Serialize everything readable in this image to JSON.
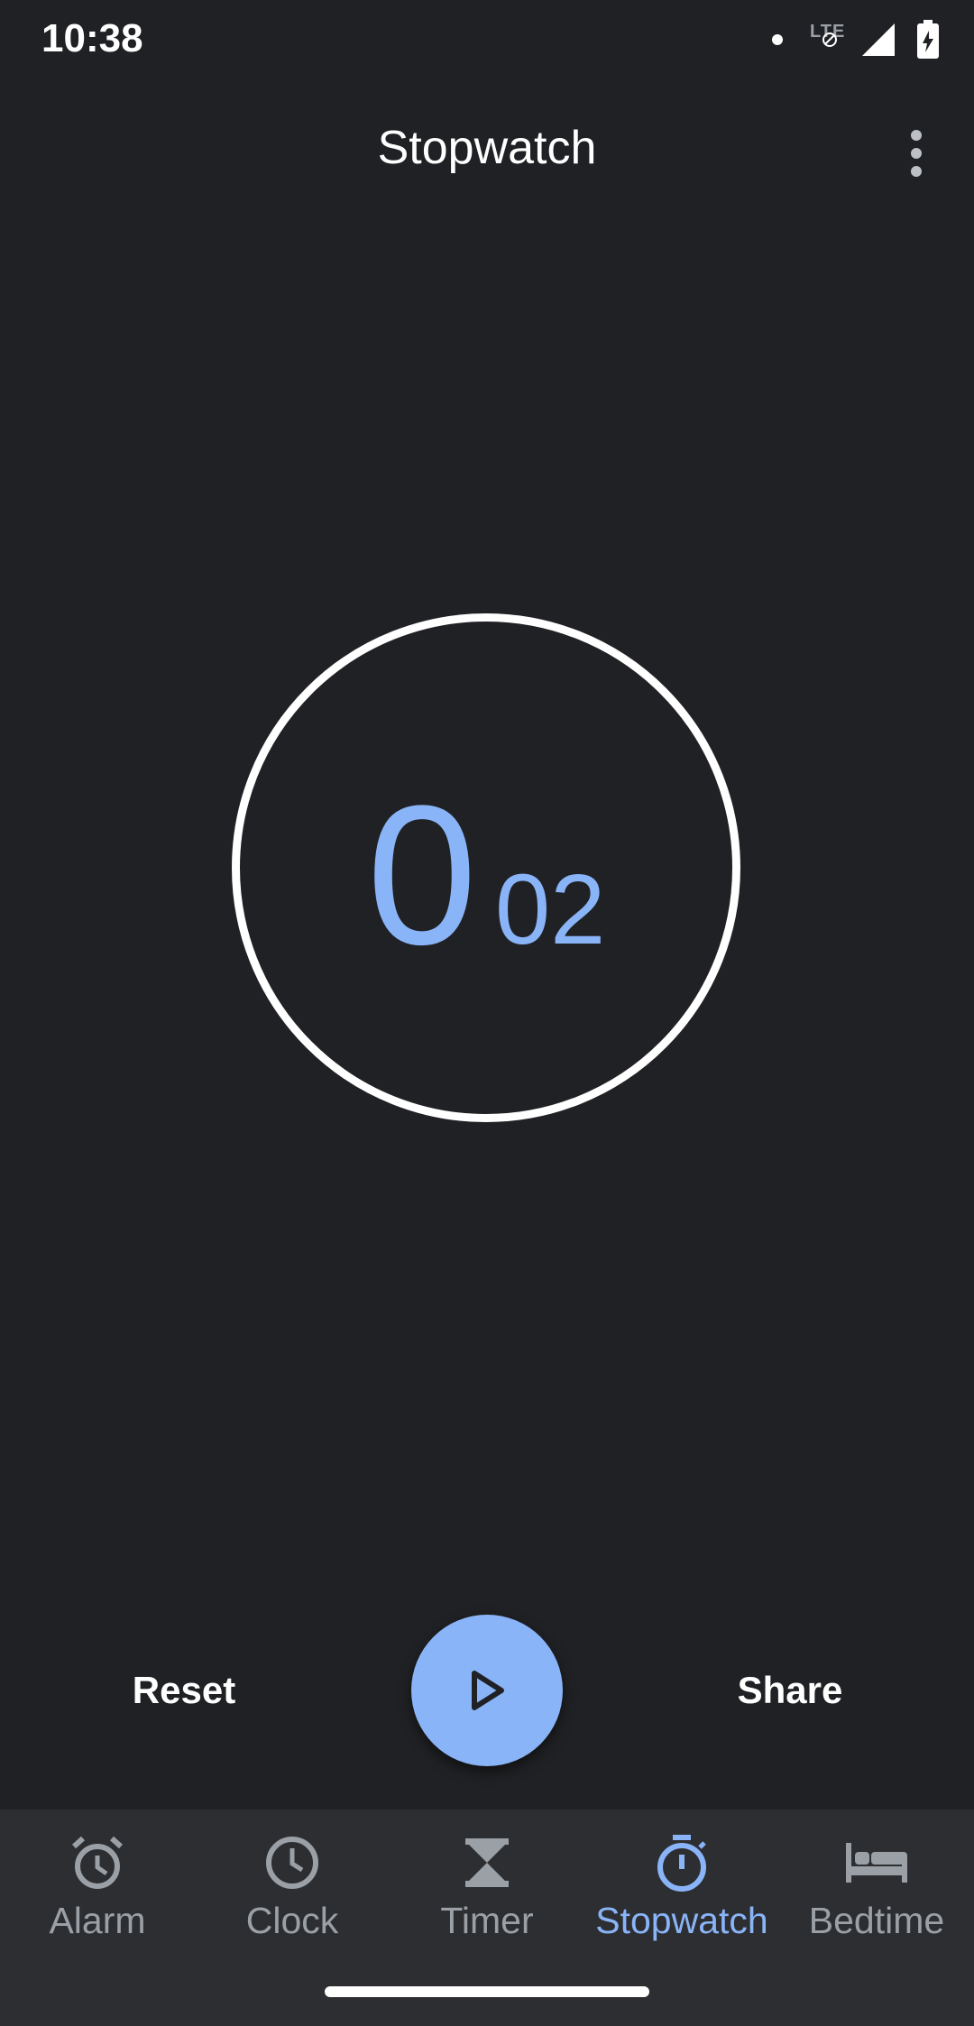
{
  "status_bar": {
    "time": "10:38",
    "network_label": "LTE",
    "icons": [
      "notification-dot-icon",
      "lte-blocked-icon",
      "cell-signal-icon",
      "battery-charging-icon"
    ]
  },
  "app_bar": {
    "title": "Stopwatch",
    "menu_icon": "more-vert-icon"
  },
  "stopwatch": {
    "seconds": "0",
    "hundredths": "02"
  },
  "controls": {
    "reset_label": "Reset",
    "share_label": "Share",
    "play_icon": "play-icon"
  },
  "bottom_nav": {
    "items": [
      {
        "label": "Alarm",
        "icon": "alarm-icon",
        "active": false
      },
      {
        "label": "Clock",
        "icon": "clock-icon",
        "active": false
      },
      {
        "label": "Timer",
        "icon": "hourglass-icon",
        "active": false
      },
      {
        "label": "Stopwatch",
        "icon": "stopwatch-icon",
        "active": true
      },
      {
        "label": "Bedtime",
        "icon": "bed-icon",
        "active": false
      }
    ]
  },
  "colors": {
    "background": "#202124",
    "nav_background": "#2d2e31",
    "accent": "#8ab4f8",
    "inactive": "#9aa0a6"
  }
}
